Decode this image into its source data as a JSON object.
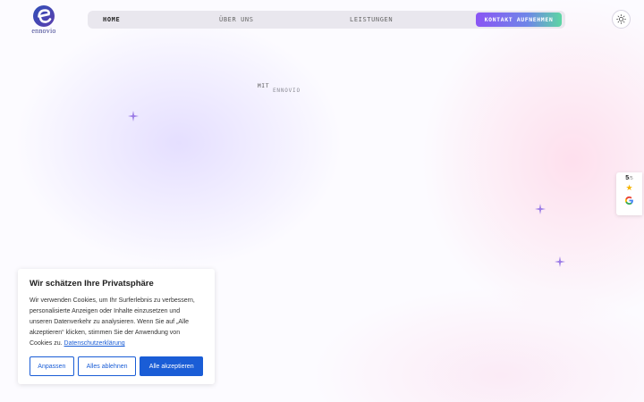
{
  "logo": {
    "text": "ennovio",
    "icon": "ennovio-e-logo"
  },
  "nav": {
    "items": [
      {
        "label": "HOME",
        "active": true
      },
      {
        "label": "ÜBER UNS",
        "active": false
      },
      {
        "label": "LEISTUNGEN",
        "active": false
      }
    ],
    "cta_label": "KONTAKT AUFNEHMEN"
  },
  "theme_toggle": {
    "icon": "sun-icon"
  },
  "hero": {
    "prefix": "MIT",
    "brand": "ENNOVIO"
  },
  "rating": {
    "score": "5",
    "max": "/5",
    "star": "★",
    "provider_icon": "google-icon"
  },
  "cookie": {
    "title": "Wir schätzen Ihre Privatsphäre",
    "text": "Wir verwenden Cookies, um Ihr Surferlebnis zu verbessern, personalisierte Anzeigen oder Inhalte einzusetzen und unseren Datenverkehr zu analysieren. Wenn Sie auf „Alle akzeptieren“ klicken, stimmen Sie der Anwendung von Cookies zu.",
    "link_label": "Datenschutzerklärung",
    "btn_customize": "Anpassen",
    "btn_reject": "Alles ablehnen",
    "btn_accept": "Alle akzeptieren"
  },
  "colors": {
    "primary": "#1a5dd6",
    "cta_gradient_start": "#8a55f4",
    "cta_gradient_end": "#5cd6a3",
    "sparkle": "#9a7ae6",
    "star": "#f5b400"
  }
}
